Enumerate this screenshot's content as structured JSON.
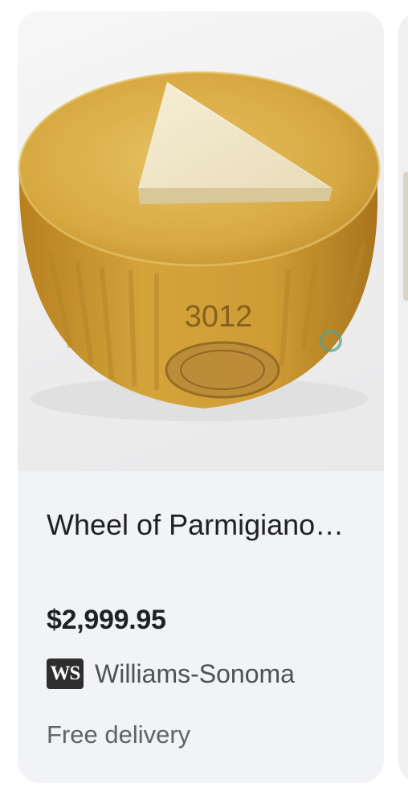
{
  "product": {
    "title": "Wheel of Parmigiano…",
    "price": "$2,999.95",
    "merchant": {
      "logo_text": "WS",
      "name": "Williams-Sonoma"
    },
    "delivery": "Free delivery",
    "image_markings": {
      "number": "3012"
    }
  },
  "colors": {
    "card_background": "#f2f3f6",
    "title_text": "#202124",
    "secondary_text": "#5f6368",
    "cheese_rind": "#c9982f",
    "cheese_wedge": "#efe4c6"
  }
}
